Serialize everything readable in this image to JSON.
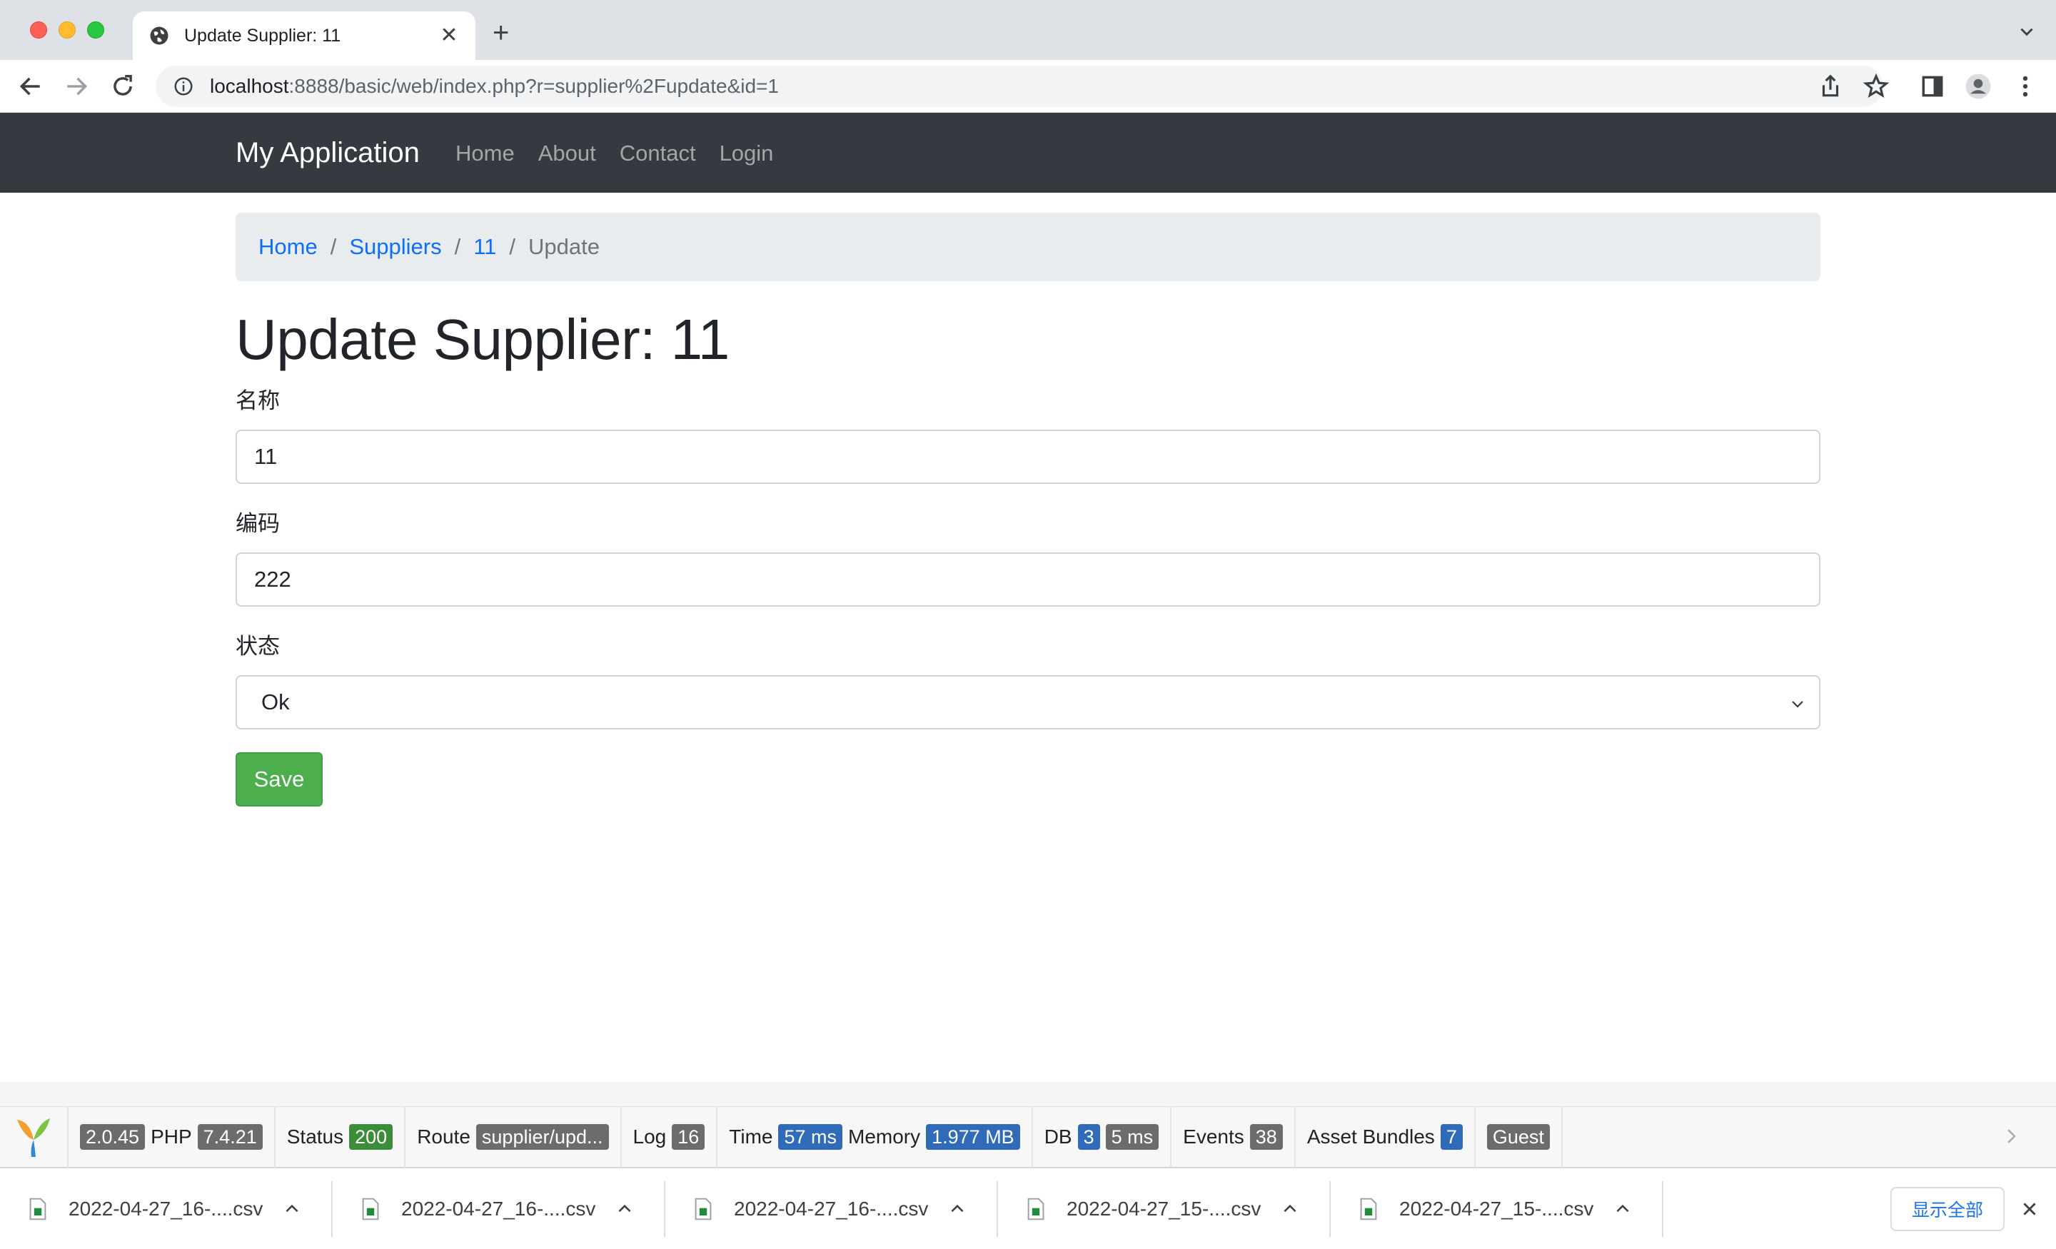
{
  "browser": {
    "tab_title": "Update Supplier: 11",
    "tab_close": "✕",
    "new_tab": "+",
    "url_host": "localhost",
    "url_rest": ":8888/basic/web/index.php?r=supplier%2Fupdate&id=1"
  },
  "navbar": {
    "brand": "My Application",
    "links": [
      "Home",
      "About",
      "Contact",
      "Login"
    ]
  },
  "breadcrumb": {
    "home": "Home",
    "suppliers": "Suppliers",
    "item": "11",
    "current": "Update",
    "separator": "/"
  },
  "page": {
    "title": "Update Supplier: 11"
  },
  "form": {
    "name_label": "名称",
    "name_value": "11",
    "code_label": "编码",
    "code_value": "222",
    "status_label": "状态",
    "status_value": "Ok",
    "save_label": "Save"
  },
  "debug": {
    "yii_version": "2.0.45",
    "php_label": "PHP",
    "php_version": "7.4.21",
    "status_label": "Status",
    "status_code": "200",
    "route_label": "Route",
    "route_value": "supplier/upd...",
    "log_label": "Log",
    "log_count": "16",
    "time_label": "Time",
    "time_value": "57 ms",
    "memory_label": "Memory",
    "memory_value": "1.977 MB",
    "db_label": "DB",
    "db_queries": "3",
    "db_time": "5 ms",
    "events_label": "Events",
    "events_count": "38",
    "assets_label": "Asset Bundles",
    "assets_count": "7",
    "user": "Guest"
  },
  "downloads": {
    "files": [
      "2022-04-27_16-....csv",
      "2022-04-27_16-....csv",
      "2022-04-27_16-....csv",
      "2022-04-27_15-....csv",
      "2022-04-27_15-....csv"
    ],
    "show_all": "显示全部"
  },
  "colors": {
    "navbar_bg": "#343a40",
    "link": "#0d6efd",
    "save_button": "#4cae4c"
  }
}
